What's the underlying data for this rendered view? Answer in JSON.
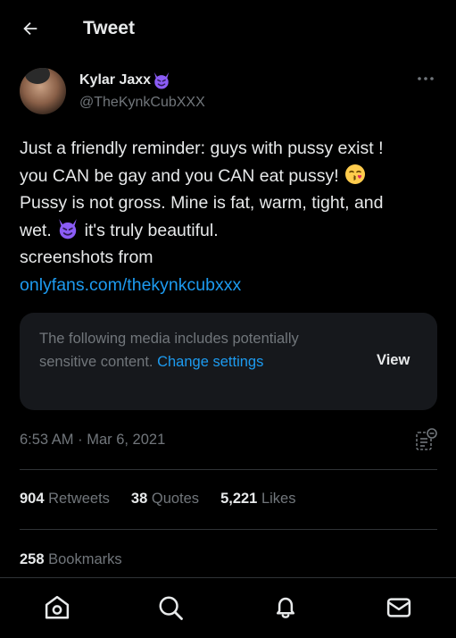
{
  "header": {
    "title": "Tweet"
  },
  "author": {
    "name": "Kylar Jaxx",
    "name_emoji": "😈",
    "handle": "@TheKynkCubXXX"
  },
  "tweet": {
    "line1": "Just a friendly reminder: guys with pussy exist !",
    "line2": "you CAN be gay and you CAN eat pussy! ",
    "line2_emoji": "😘",
    "line3": "Pussy is not gross. Mine is fat, warm, tight, and",
    "line4_a": "wet. ",
    "line4_emoji": "😈",
    "line4_b": " it's truly beautiful.",
    "line5": "screenshots from",
    "link": "onlyfans.com/thekynkcubxxx"
  },
  "media_warning": {
    "text": "The following media includes potentially sensitive content.",
    "change_link": "Change settings",
    "view_button": "View"
  },
  "timestamp": "6:53 AM · Mar 6, 2021",
  "stats": {
    "retweets_count": "904",
    "retweets_label": "Retweets",
    "quotes_count": "38",
    "quotes_label": "Quotes",
    "likes_count": "5,221",
    "likes_label": "Likes",
    "bookmarks_count": "258",
    "bookmarks_label": "Bookmarks"
  },
  "colors": {
    "background": "#000000",
    "text_primary": "#e7e9ea",
    "text_secondary": "#71767b",
    "accent_link": "#1d9bf0",
    "card_background": "#16181c",
    "divider": "#2f3336",
    "emoji_devil": "#8b5cf6"
  },
  "icons": [
    "back-arrow-icon",
    "more-dots-icon",
    "analytics-icon",
    "home-icon",
    "search-icon",
    "notifications-bell-icon",
    "messages-envelope-icon"
  ]
}
